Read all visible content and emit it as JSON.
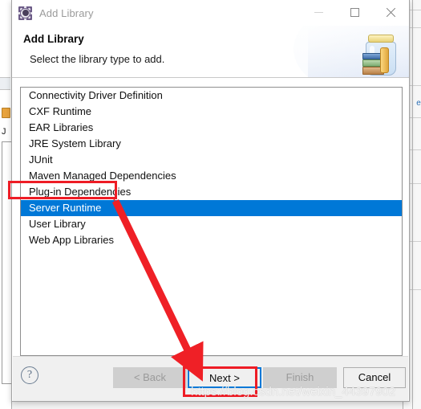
{
  "window": {
    "title": "Add Library",
    "icon": "gear-icon",
    "controls": {
      "minimize": "minimize-icon",
      "maximize": "maximize-icon",
      "close": "close-icon"
    }
  },
  "header": {
    "title": "Add Library",
    "subtitle": "Select the library type to add.",
    "art": "jar-with-books-illustration"
  },
  "list": {
    "items": [
      {
        "label": "Connectivity Driver Definition",
        "selected": false
      },
      {
        "label": "CXF Runtime",
        "selected": false
      },
      {
        "label": "EAR Libraries",
        "selected": false
      },
      {
        "label": "JRE System Library",
        "selected": false
      },
      {
        "label": "JUnit",
        "selected": false
      },
      {
        "label": "Maven Managed Dependencies",
        "selected": false
      },
      {
        "label": "Plug-in Dependencies",
        "selected": false
      },
      {
        "label": "Server Runtime",
        "selected": true
      },
      {
        "label": "User Library",
        "selected": false
      },
      {
        "label": "Web App Libraries",
        "selected": false
      }
    ],
    "selected_index": 7,
    "selection_color": "#0078d7"
  },
  "footer": {
    "help_icon": "help-question-icon",
    "buttons": [
      {
        "label": "< Back",
        "state": "disabled"
      },
      {
        "label": "Next >",
        "state": "focused"
      },
      {
        "label": "Finish",
        "state": "disabled"
      },
      {
        "label": "Cancel",
        "state": "normal"
      }
    ]
  },
  "annotations": {
    "highlight_color": "#ee1c25",
    "item_box_target": "Server Runtime",
    "button_box_target": "Next >",
    "arrow": "red-arrow-from-server-runtime-to-next-button"
  },
  "watermark": {
    "text": "https://blog.csdn.net/weixin_44397902"
  },
  "background": {
    "left_text": "J",
    "right_fragment": "e"
  }
}
